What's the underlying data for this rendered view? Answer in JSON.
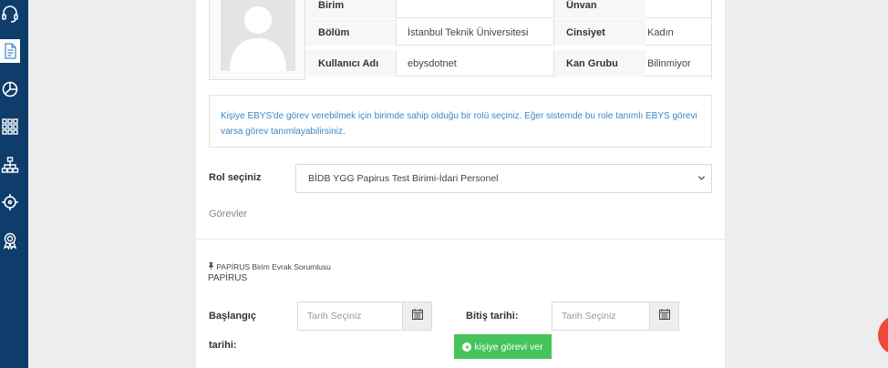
{
  "sidebar": {
    "icons": [
      "headset-icon",
      "document-icon",
      "pie-chart-icon",
      "grid-icon",
      "org-chart-icon",
      "target-icon",
      "award-icon"
    ]
  },
  "profile": {
    "rows": [
      {
        "label1": "Birim",
        "value1": "",
        "label2": "Ünvan",
        "value2": ""
      },
      {
        "label1": "Bölüm",
        "value1": "İstanbul Teknik Üniversitesi",
        "label2": "Cinsiyet",
        "value2": "Kadın"
      },
      {
        "label1": "Kullanıcı Adı",
        "value1": "ebysdotnet",
        "label2": "Kan Grubu",
        "value2": "Bilinmiyor"
      }
    ]
  },
  "alert": {
    "text": "Kişiye EBYS'de görev verebilmek için birimde sahip olduğu bir rolü seçiniz. Eğer sistemde bu role tanımlı EBYS görevi varsa görev tanımlayabilirsiniz."
  },
  "role": {
    "label": "Rol seçiniz",
    "selected": "BİDB YGG Papirus Test Birimi-İdari Personel"
  },
  "tasks": {
    "heading": "Görevler",
    "task_title": "PAPİRUS Birim Evrak Sorumlusu",
    "task_sub": "PAPİRUS"
  },
  "dates": {
    "start_label_line1": "Başlangıç",
    "start_label_line2": "tarihi:",
    "start_placeholder": "Tarih Seçiniz",
    "end_label": "Bitiş tarihi:",
    "end_placeholder": "Tarih Seçiniz"
  },
  "actions": {
    "give_label": "kişiye görevi ver"
  },
  "colors": {
    "sidebar": "#0e3c6b",
    "alert_text": "#3d86c6",
    "button": "#45c45b",
    "fab": "#f0483e"
  }
}
